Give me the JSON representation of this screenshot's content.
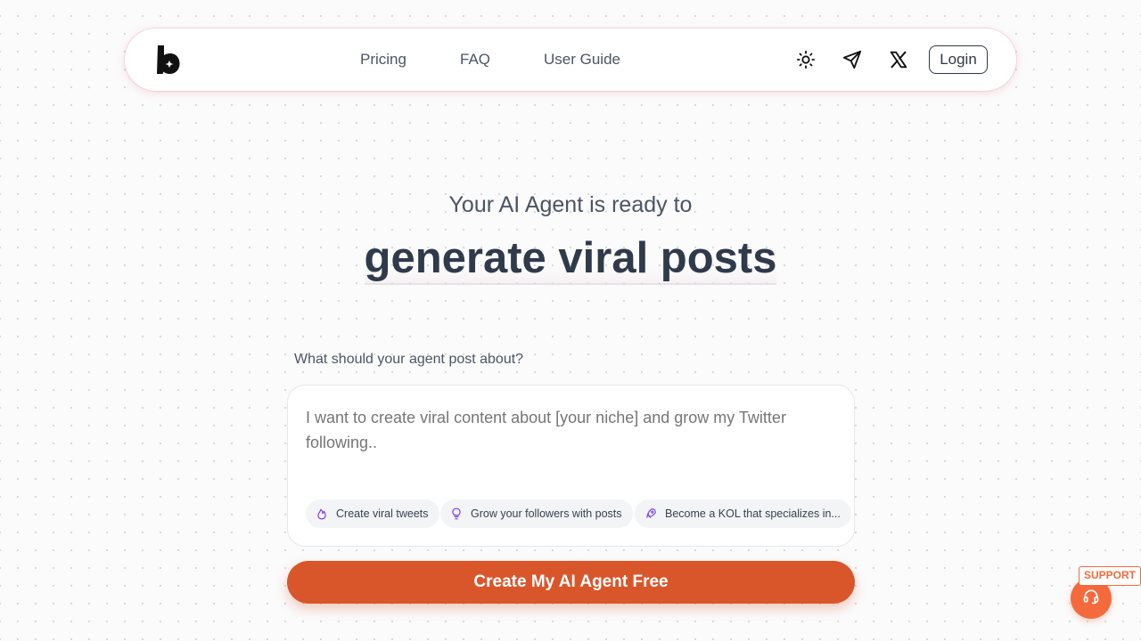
{
  "nav": {
    "links": [
      "Pricing",
      "FAQ",
      "User Guide"
    ],
    "login_label": "Login",
    "icons": [
      "sun-icon",
      "send-icon",
      "x-logo-icon"
    ]
  },
  "hero": {
    "subtitle": "Your AI Agent is ready to",
    "title": "generate viral posts"
  },
  "prompt": {
    "label": "What should your agent post about?",
    "placeholder": "I want to create viral content about [your niche] and grow my Twitter following..",
    "chips": [
      {
        "label": "Create viral tweets",
        "icon": "flame-icon"
      },
      {
        "label": "Grow your followers with posts",
        "icon": "lightbulb-icon"
      },
      {
        "label": "Become a KOL that specializes in...",
        "icon": "rocket-icon"
      }
    ]
  },
  "cta": {
    "label": "Create My AI Agent Free"
  },
  "support": {
    "label": "SUPPORT",
    "icon": "headset-icon"
  },
  "colors": {
    "accent": "#d9562b",
    "support": "#f56a3c",
    "chip_icon": "#7c3aed",
    "text": "#374151"
  }
}
